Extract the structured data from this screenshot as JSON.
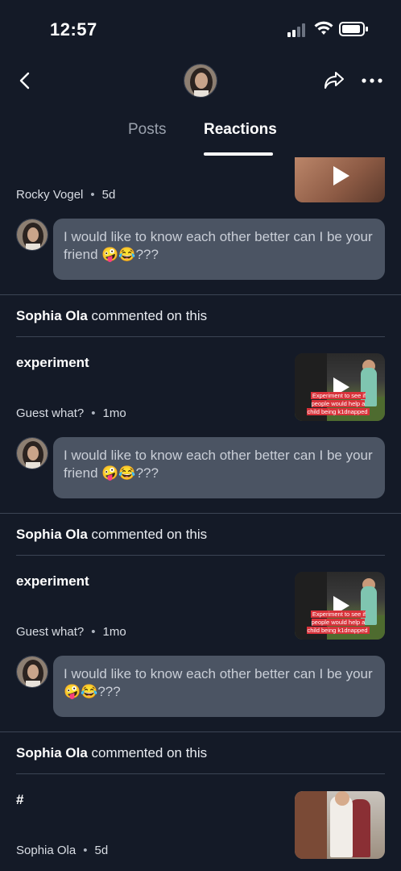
{
  "status": {
    "time": "12:57"
  },
  "tabs": {
    "posts": "Posts",
    "reactions": "Reactions"
  },
  "feed": {
    "top": {
      "author": "Rocky Vogel",
      "age": "5d",
      "comment": "I would like to know each other better can I be your friend 🤪😂???"
    },
    "items": [
      {
        "commenter": "Sophia Ola",
        "action": "commented on this",
        "title": "experiment",
        "author": "Guest what?",
        "age": "1mo",
        "thumb_caption": "Experiment to see if people would help a child being k1dnapped",
        "comment": "I would like to know each other better can I be your friend 🤪😂???"
      },
      {
        "commenter": "Sophia Ola",
        "action": "commented on this",
        "title": "experiment",
        "author": "Guest what?",
        "age": "1mo",
        "thumb_caption": "Experiment to see if people would help a child being k1dnapped",
        "comment": "I would like to know each other better can I be your 🤪😂???"
      },
      {
        "commenter": "Sophia Ola",
        "action": "commented on this",
        "title": "#",
        "author": "Sophia Ola",
        "age": "5d"
      }
    ]
  },
  "icons": {
    "back": "chevron-left-icon",
    "share": "share-icon",
    "more": "more-horizontal-icon",
    "play": "play-icon"
  },
  "colors": {
    "background": "#141a27",
    "bubble": "#4b5463",
    "separator": "#3c4454"
  }
}
